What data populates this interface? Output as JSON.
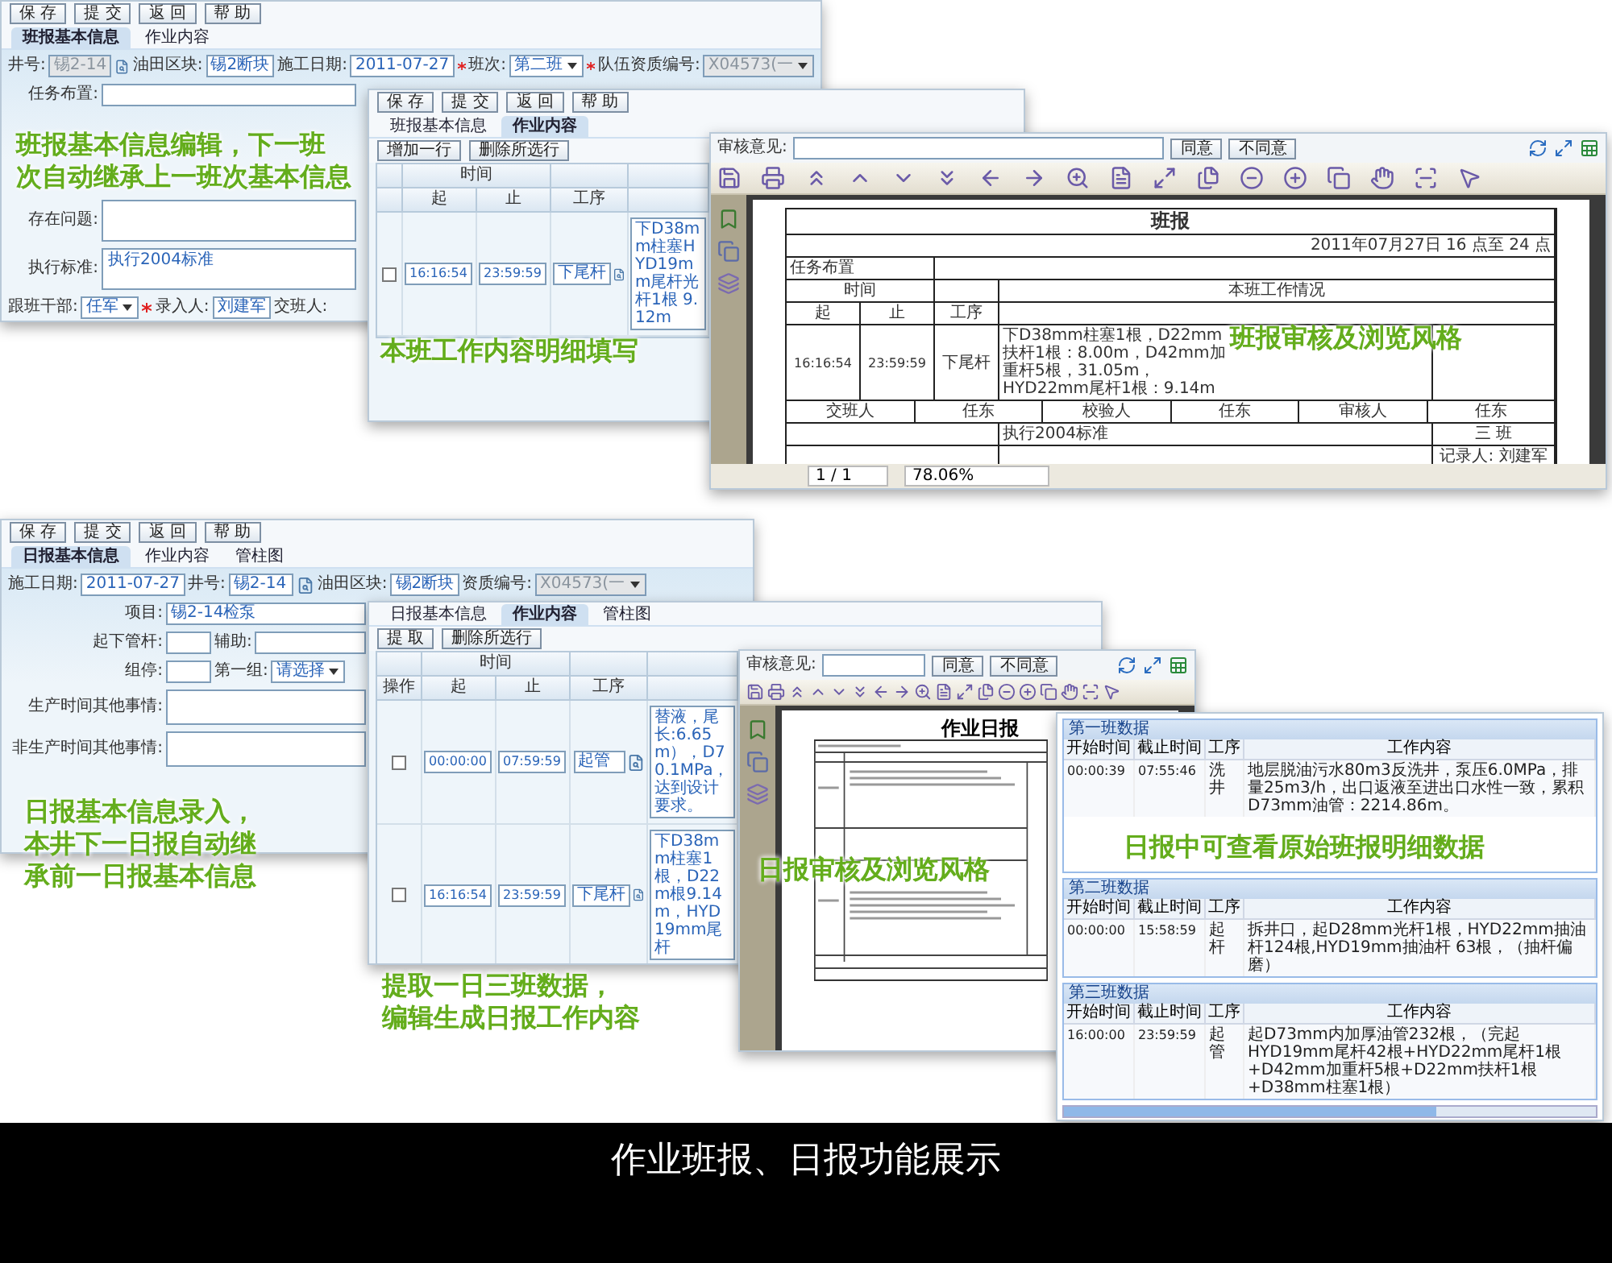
{
  "windows": [
    {
      "kind": "shift_form",
      "buttons": [
        "保 存",
        "提 交",
        "返 回",
        "帮 助"
      ],
      "tabs": [
        {
          "label": "班报基本信息",
          "selected": true
        },
        {
          "label": "作业内容",
          "selected": false
        }
      ],
      "header_fields": [
        {
          "label": "井号:",
          "value": "锡2-14",
          "kind": "text",
          "disabled": true,
          "required": false,
          "lookup": true
        },
        {
          "label": "油田区块:",
          "value": "锡2断块",
          "kind": "text",
          "disabled": false,
          "required": false,
          "lookup": false
        },
        {
          "label": "施工日期:",
          "value": "2011-07-27",
          "kind": "text",
          "disabled": false,
          "required": false,
          "lookup": false
        },
        {
          "label": "班次:",
          "value": "第二班",
          "kind": "select",
          "disabled": false,
          "required": true,
          "lookup": false
        },
        {
          "label": "队伍资质编号:",
          "value": "X04573(一",
          "kind": "select",
          "disabled": true,
          "required": true,
          "lookup": false
        }
      ],
      "rows": [
        {
          "label": "任务布置:",
          "kind": "line"
        },
        {
          "label": "存在问题:",
          "kind": "area"
        },
        {
          "label": "执行标准:",
          "kind": "area",
          "value": "执行2004标准"
        }
      ],
      "footer_fields": [
        {
          "label": "跟班干部:",
          "value": "任军",
          "kind": "select",
          "required": false,
          "lookup": false
        },
        {
          "label": "录入人:",
          "value": "刘建军",
          "kind": "text",
          "required": true,
          "lookup": false
        },
        {
          "label": "交班人:",
          "kind": "none",
          "required": false,
          "lookup": false
        }
      ],
      "caption": [
        "班报基本信息编辑，下一班",
        "次自动继承上一班次基本信息"
      ]
    },
    {
      "kind": "grid",
      "buttons": [
        "保 存",
        "提 交",
        "返 回",
        "帮 助"
      ],
      "tabs": [
        {
          "label": "班报基本信息",
          "selected": false
        },
        {
          "label": "作业内容",
          "selected": true
        }
      ],
      "actions": [
        "增加一行",
        "删除所选行"
      ],
      "group_header": "时间",
      "columns": [
        "起",
        "止",
        "工序"
      ],
      "rows": [
        {
          "checked": false,
          "start": "16:16:54",
          "end": "23:59:59",
          "step": "下尾杆",
          "content": "下D38mm柱塞HYD19mm尾杆光杆1根 9.12m"
        }
      ],
      "caption": [
        "本班工作内容明细填写"
      ]
    },
    {
      "kind": "viewer",
      "review_label": "审核意见:",
      "buttons": [
        "同意",
        "不同意"
      ],
      "document": {
        "kind": "shift",
        "title": "班报",
        "date": "2011年07月27日 16 点至 24 点",
        "task_label": "任务布置",
        "group_header": "时间",
        "columns": [
          "起",
          "止",
          "工序"
        ],
        "content_header": "本班工作情况",
        "row": {
          "start": "16:16:54",
          "end": "23:59:59",
          "step": "下尾杆",
          "content": "下D38mm柱塞1根，D22mm扶杆1根：8.00m，D42mm加重杆5根，31.05m，HYD22mm尾杆1根：9.14m"
        },
        "signatures": [
          "交班人",
          "任东",
          "校验人",
          "任东",
          "审核人",
          "任东"
        ],
        "standard": "执行2004标准",
        "shift": "三 班",
        "recorder": "记录人: 刘建军"
      },
      "page": "1 / 1",
      "zoom": "78.06%",
      "caption": [
        "班报审核及浏览风格"
      ]
    },
    {
      "kind": "daily_form",
      "buttons": [
        "保 存",
        "提 交",
        "返 回",
        "帮 助"
      ],
      "tabs": [
        {
          "label": "日报基本信息",
          "selected": true
        },
        {
          "label": "作业内容",
          "selected": false
        },
        {
          "label": "管柱图",
          "selected": false
        }
      ],
      "header_fields": [
        {
          "label": "施工日期:",
          "value": "2011-07-27",
          "kind": "text",
          "disabled": false,
          "required": false,
          "lookup": false
        },
        {
          "label": "井号:",
          "value": "锡2-14",
          "kind": "text",
          "disabled": false,
          "required": false,
          "lookup": true
        },
        {
          "label": "油田区块:",
          "value": "锡2断块",
          "kind": "text",
          "disabled": false,
          "required": false,
          "lookup": false
        },
        {
          "label": "资质编号:",
          "value": "X04573(一",
          "kind": "select",
          "disabled": true,
          "required": false,
          "lookup": false
        }
      ],
      "rows": [
        {
          "label": "项目:",
          "kind": "line",
          "value": "锡2-14检泵"
        },
        {
          "label": "起下管杆:",
          "kind": "pair",
          "pair": {
            "label": "辅助:",
            "kind": "text"
          }
        },
        {
          "label": "组停:",
          "kind": "pair",
          "pair": {
            "label": "第一组:",
            "kind": "select",
            "value": "请选择"
          }
        },
        {
          "label": "生产时间其他事情:",
          "kind": "area"
        },
        {
          "label": "非生产时间其他事情:",
          "kind": "area"
        }
      ],
      "caption": [
        "日报基本信息录入，",
        "本井下一日报自动继",
        "承前一日报基本信息"
      ]
    },
    {
      "kind": "grid",
      "tabs": [
        {
          "label": "日报基本信息",
          "selected": false
        },
        {
          "label": "作业内容",
          "selected": true
        },
        {
          "label": "管柱图",
          "selected": false
        }
      ],
      "actions": [
        "提 取",
        "删除所选行"
      ],
      "op_header": "操作",
      "group_header": "时间",
      "columns": [
        "起",
        "止",
        "工序"
      ],
      "rows": [
        {
          "checked": false,
          "start": "00:00:00",
          "end": "07:59:59",
          "step": "起管",
          "content": "替液，尾长:6.65m），D70.1MPa，达到设计要求。"
        },
        {
          "checked": false,
          "start": "16:16:54",
          "end": "23:59:59",
          "step": "下尾杆",
          "content": "下D38mm柱塞1根，D22m根9.14m，HYD19mm尾杆"
        }
      ],
      "caption": [
        "提取一日三班数据，",
        "编辑生成日报工作内容"
      ]
    },
    {
      "kind": "viewer",
      "review_label": "审核意见:",
      "buttons": [
        "同意",
        "不同意"
      ],
      "document": {
        "kind": "daily",
        "title": "作业日报"
      },
      "caption": [
        "日报审核及浏览风格"
      ]
    },
    {
      "kind": "raw",
      "sections": [
        {
          "title": "第一班数据",
          "columns": [
            "开始时间",
            "截止时间",
            "工序",
            "工作内容"
          ],
          "rows": [
            {
              "start": "00:00:39",
              "end": "07:55:46",
              "step": "洗井",
              "content": "地层脱油污水80m3反洗井，泵压6.0MPa，排量25m3/h，出口返液至进出口水性一致，累积D73mm油管：2214.86m。"
            }
          ]
        },
        {
          "title": "第二班数据",
          "columns": [
            "开始时间",
            "截止时间",
            "工序",
            "工作内容"
          ],
          "rows": [
            {
              "start": "00:00:00",
              "end": "15:58:59",
              "step": "起杆",
              "content": "拆井口，起D28mm光杆1根，HYD22mm抽油杆124根,HYD19mm抽油杆 63根，（抽杆偏磨）"
            }
          ]
        },
        {
          "title": "第三班数据",
          "columns": [
            "开始时间",
            "截止时间",
            "工序",
            "工作内容"
          ],
          "rows": [
            {
              "start": "16:00:00",
              "end": "23:59:59",
              "step": "起管",
              "content": "起D73mm内加厚油管232根，（完起HYD19mm尾杆42根+HYD22mm尾杆1根+D42mm加重杆5根+D22mm扶杆1根+D38mm柱塞1根）"
            }
          ]
        }
      ],
      "caption": [
        "日报中可查看原始班报明细数据"
      ]
    }
  ],
  "footer": {
    "title": "作业班报、日报功能展示"
  }
}
